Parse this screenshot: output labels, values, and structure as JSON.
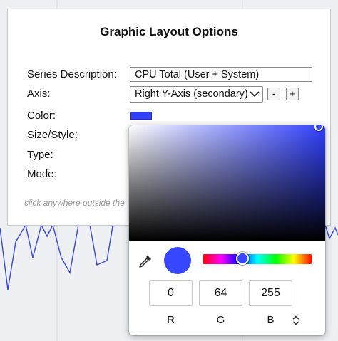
{
  "dialog": {
    "title": "Graphic Layout Options",
    "labels": {
      "series_description": "Series Description:",
      "axis": "Axis:",
      "color": "Color:",
      "size_style": "Size/Style:",
      "type": "Type:",
      "mode": "Mode:"
    },
    "series_description_value": "CPU Total (User + System)",
    "axis_selected": "Right Y-Axis (secondary)",
    "minus_label": "-",
    "plus_label": "+",
    "series_color": "#2f40ff",
    "hint": "click anywhere outside the"
  },
  "color_picker": {
    "hue_color": "#2f40ff",
    "preview_color": "#3747ff",
    "channels": [
      {
        "label": "R",
        "value": "0"
      },
      {
        "label": "G",
        "value": "64"
      },
      {
        "label": "B",
        "value": "255"
      }
    ],
    "icons": [
      "eyedropper-icon",
      "updown-chevron-icon"
    ]
  },
  "background_chart": {
    "line_color": "#3a46d6",
    "gridline_color": "#d4d7dc"
  }
}
